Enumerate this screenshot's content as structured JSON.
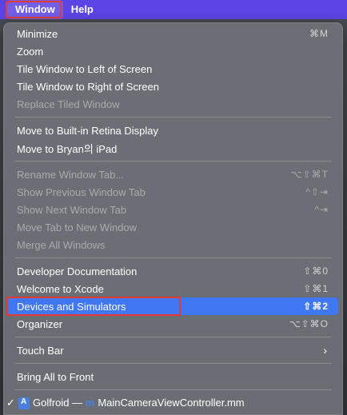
{
  "menubar": {
    "items": [
      {
        "label": "Window"
      },
      {
        "label": "Help"
      }
    ]
  },
  "menu": {
    "group1": [
      {
        "label": "Minimize",
        "shortcut": "⌘M",
        "disabled": false
      },
      {
        "label": "Zoom",
        "shortcut": "",
        "disabled": false
      },
      {
        "label": "Tile Window to Left of Screen",
        "shortcut": "",
        "disabled": false
      },
      {
        "label": "Tile Window to Right of Screen",
        "shortcut": "",
        "disabled": false
      },
      {
        "label": "Replace Tiled Window",
        "shortcut": "",
        "disabled": true
      }
    ],
    "group2": [
      {
        "label": "Move to Built-in Retina Display",
        "shortcut": "",
        "disabled": false
      },
      {
        "label": "Move to Bryan의 iPad",
        "shortcut": "",
        "disabled": false
      }
    ],
    "group3": [
      {
        "label": "Rename Window Tab...",
        "shortcut": "⌥⇧⌘T",
        "disabled": true
      },
      {
        "label": "Show Previous Window Tab",
        "shortcut": "^⇧⇥",
        "disabled": true
      },
      {
        "label": "Show Next Window Tab",
        "shortcut": "^⇥",
        "disabled": true
      },
      {
        "label": "Move Tab to New Window",
        "shortcut": "",
        "disabled": true
      },
      {
        "label": "Merge All Windows",
        "shortcut": "",
        "disabled": true
      }
    ],
    "group4": [
      {
        "label": "Developer Documentation",
        "shortcut": "⇧⌘0",
        "disabled": false
      },
      {
        "label": "Welcome to Xcode",
        "shortcut": "⇧⌘1",
        "disabled": false
      },
      {
        "label": "Devices and Simulators",
        "shortcut": "⇧⌘2",
        "disabled": false
      },
      {
        "label": "Organizer",
        "shortcut": "⌥⇧⌘O",
        "disabled": false
      }
    ],
    "touch_bar": {
      "label": "Touch Bar",
      "chevron": "›"
    },
    "bring_all": {
      "label": "Bring All to Front"
    },
    "window_entry": {
      "check": "✓",
      "project": "Golfroid",
      "sep": "—",
      "file": "MainCameraViewController.mm"
    }
  },
  "colors": {
    "menubar": "#5b44e3",
    "highlight": "#3f78f2",
    "annotation": "#e53935"
  }
}
